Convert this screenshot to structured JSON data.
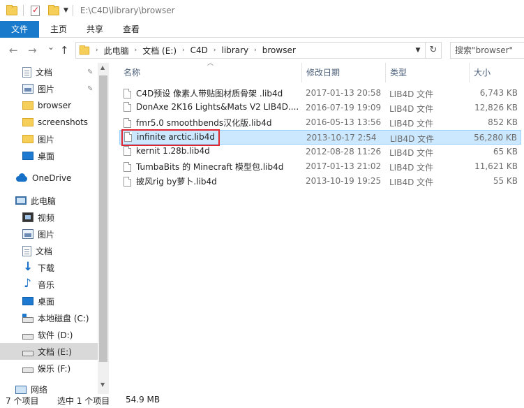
{
  "titlebar": {
    "path": "E:\\C4D\\library\\browser"
  },
  "ribbon": {
    "tabs": [
      "文件",
      "主页",
      "共享",
      "查看"
    ]
  },
  "nav": {
    "back": "←",
    "forward": "→",
    "recent": "⌄",
    "up": "↑",
    "breadcrumbs": [
      "此电脑",
      "文档 (E:)",
      "C4D",
      "library",
      "browser"
    ],
    "search_placeholder": "搜索\"browser\"",
    "refresh": "↻"
  },
  "sidebar": {
    "items": [
      {
        "label": "文档",
        "icon": "document-icon",
        "pinned": true
      },
      {
        "label": "图片",
        "icon": "pictures-icon",
        "pinned": true
      },
      {
        "label": "browser",
        "icon": "folder-icon"
      },
      {
        "label": "screenshots",
        "icon": "folder-icon"
      },
      {
        "label": "图片",
        "icon": "folder-icon"
      },
      {
        "label": "桌面",
        "icon": "desktop-icon"
      },
      {
        "label": "OneDrive",
        "icon": "onedrive-icon"
      },
      {
        "label": "此电脑",
        "icon": "this-pc-icon"
      },
      {
        "label": "视频",
        "icon": "videos-icon"
      },
      {
        "label": "图片",
        "icon": "pictures-icon"
      },
      {
        "label": "文档",
        "icon": "document-icon"
      },
      {
        "label": "下载",
        "icon": "download-icon"
      },
      {
        "label": "音乐",
        "icon": "music-icon"
      },
      {
        "label": "桌面",
        "icon": "desktop-icon"
      },
      {
        "label": "本地磁盘 (C:)",
        "icon": "system-drive-icon"
      },
      {
        "label": "软件 (D:)",
        "icon": "drive-icon"
      },
      {
        "label": "文档 (E:)",
        "icon": "drive-icon",
        "selected": true
      },
      {
        "label": "娱乐 (F:)",
        "icon": "drive-icon"
      },
      {
        "label": "网络",
        "icon": "network-icon"
      }
    ]
  },
  "columns": {
    "name": "名称",
    "date": "修改日期",
    "type": "类型",
    "size": "大小"
  },
  "files": [
    {
      "name": "C4D预设 像素人带贴图材质骨架 .lib4d",
      "date": "2017-01-13 20:58",
      "type": "LIB4D 文件",
      "size": "6,743 KB"
    },
    {
      "name": "DonAxe 2K16 Lights&Mats V2 LIB4D....",
      "date": "2016-07-19 19:09",
      "type": "LIB4D 文件",
      "size": "12,826 KB"
    },
    {
      "name": "fmr5.0 smoothbends汉化版.lib4d",
      "date": "2016-05-13 13:56",
      "type": "LIB4D 文件",
      "size": "852 KB"
    },
    {
      "name": "infinite arctic.lib4d",
      "date": "2013-10-17 2:54",
      "type": "LIB4D 文件",
      "size": "56,280 KB",
      "selected": true
    },
    {
      "name": "kernit 1.28b.lib4d",
      "date": "2012-08-28 11:26",
      "type": "LIB4D 文件",
      "size": "65 KB"
    },
    {
      "name": "TumbaBits 的 Minecraft 模型包.lib4d",
      "date": "2017-01-13 21:02",
      "type": "LIB4D 文件",
      "size": "11,621 KB"
    },
    {
      "name": "披风rig by萝卜.lib4d",
      "date": "2013-10-19 19:25",
      "type": "LIB4D 文件",
      "size": "55 KB"
    }
  ],
  "status": {
    "item_count": "7 个项目",
    "selected": "选中 1 个项目",
    "selected_size": "54.9 MB"
  }
}
